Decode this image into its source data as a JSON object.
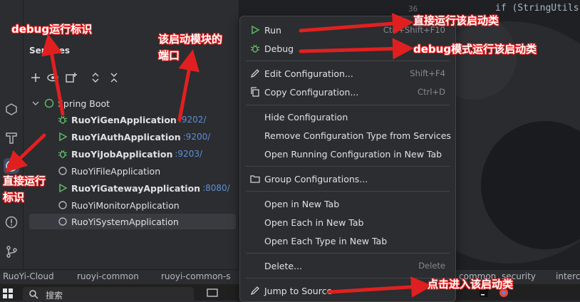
{
  "services_panel": {
    "title": "Services",
    "tree_root": "Spring Boot",
    "apps": [
      {
        "name": "RuoYiGenApplication",
        "port": ":9202/",
        "state": "debug",
        "bold": true
      },
      {
        "name": "RuoYiAuthApplication",
        "port": ":9200/",
        "state": "run",
        "bold": true
      },
      {
        "name": "RuoYiJobApplication",
        "port": ":9203/",
        "state": "debug",
        "bold": true
      },
      {
        "name": "RuoYiFileApplication",
        "port": "",
        "state": "idle",
        "bold": false
      },
      {
        "name": "RuoYiGatewayApplication",
        "port": ":8080/",
        "state": "run",
        "bold": true
      },
      {
        "name": "RuoYiMonitorApplication",
        "port": "",
        "state": "idle",
        "bold": false
      },
      {
        "name": "RuoYiSystemApplication",
        "port": "",
        "state": "idle",
        "bold": false
      }
    ]
  },
  "editor": {
    "line_number": "36",
    "code_fragment": "if (StringUtils"
  },
  "context_menu": {
    "items": [
      {
        "label": "Run",
        "shortcut": "Ctrl+Shift+F10"
      },
      {
        "label": "Debug",
        "shortcut": ""
      },
      {
        "label": "Edit Configuration...",
        "shortcut": "Shift+F4"
      },
      {
        "label": "Copy Configuration...",
        "shortcut": "Ctrl+D"
      },
      {
        "label": "Hide Configuration",
        "shortcut": ""
      },
      {
        "label": "Remove Configuration Type from Services",
        "shortcut": ""
      },
      {
        "label": "Open Running Configuration in New Tab",
        "shortcut": ""
      },
      {
        "label": "Group Configurations...",
        "shortcut": ""
      },
      {
        "label": "Open in New Tab",
        "shortcut": ""
      },
      {
        "label": "Open Each in New Tab",
        "shortcut": ""
      },
      {
        "label": "Open Each Type in New Tab",
        "shortcut": ""
      },
      {
        "label": "Delete...",
        "shortcut": "Delete"
      },
      {
        "label": "Jump to Source",
        "shortcut": ""
      }
    ]
  },
  "breadcrumb": [
    "RuoYi-Cloud",
    "ruoyi-common",
    "ruoyi-common-s",
    "common",
    "security",
    "interc"
  ],
  "taskbar": {
    "search_placeholder": "搜索"
  },
  "annotations": {
    "debug_marker": "debug运行标识",
    "module_port": "该启动模块的",
    "module_port_2": "端口",
    "run_marker": "直接运行",
    "run_marker_2": "标识",
    "run_class": "直接运行该启动类",
    "debug_class": "debug模式运行该启动类",
    "jump_class": "点击进入该启动类"
  },
  "colors": {
    "accent_red": "#e02020",
    "run_green": "#5fb865",
    "port_blue": "#5f8ed6",
    "bg": "#2b2d30"
  }
}
